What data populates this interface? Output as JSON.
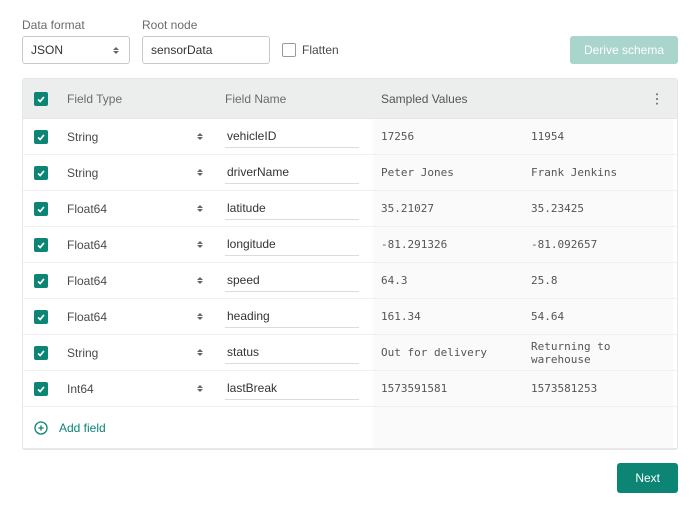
{
  "controls": {
    "data_format_label": "Data format",
    "data_format_value": "JSON",
    "root_node_label": "Root node",
    "root_node_value": "sensorData",
    "flatten_label": "Flatten",
    "flatten_checked": false,
    "derive_button": "Derive schema"
  },
  "table": {
    "headers": {
      "field_type": "Field Type",
      "field_name": "Field Name",
      "sampled": "Sampled Values"
    },
    "rows": [
      {
        "checked": true,
        "type": "String",
        "name": "vehicleID",
        "s1": "17256",
        "s2": "11954"
      },
      {
        "checked": true,
        "type": "String",
        "name": "driverName",
        "s1": "Peter Jones",
        "s2": "Frank Jenkins"
      },
      {
        "checked": true,
        "type": "Float64",
        "name": "latitude",
        "s1": "35.21027",
        "s2": "35.23425"
      },
      {
        "checked": true,
        "type": "Float64",
        "name": "longitude",
        "s1": "-81.291326",
        "s2": "-81.092657"
      },
      {
        "checked": true,
        "type": "Float64",
        "name": "speed",
        "s1": "64.3",
        "s2": "25.8"
      },
      {
        "checked": true,
        "type": "Float64",
        "name": "heading",
        "s1": "161.34",
        "s2": "54.64"
      },
      {
        "checked": true,
        "type": "String",
        "name": "status",
        "s1": "Out for delivery",
        "s2": "Returning to warehouse"
      },
      {
        "checked": true,
        "type": "Int64",
        "name": "lastBreak",
        "s1": "1573591581",
        "s2": "1573581253"
      }
    ],
    "add_field_label": "Add field"
  },
  "footer": {
    "next_button": "Next"
  }
}
